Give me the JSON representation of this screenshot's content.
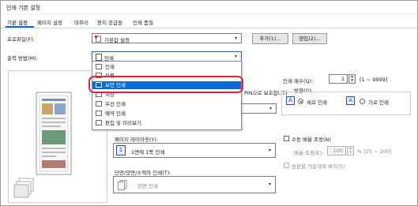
{
  "window": {
    "title": "인쇄 기본 설정"
  },
  "tabs": [
    {
      "label": "기본 설정"
    },
    {
      "label": "페이지 설정"
    },
    {
      "label": "마무리"
    },
    {
      "label": "용지 공급원"
    },
    {
      "label": "인쇄 품질"
    }
  ],
  "profile": {
    "label": "프로파일(F):",
    "value": "기본값 설정",
    "add_button": "추가(1)...",
    "edit_button": "편집(2)..."
  },
  "output_method": {
    "label": "출력 방법(M):",
    "value": "인쇄"
  },
  "dropdown": {
    "items": [
      {
        "label": "인쇄"
      },
      {
        "label": "보류"
      },
      {
        "label": "보안 인쇄"
      },
      {
        "label": "저장"
      },
      {
        "label": "우선 인쇄"
      },
      {
        "label": "예약 인쇄"
      },
      {
        "label": "편집 및 미리보기"
      }
    ],
    "selected_index": 2
  },
  "pin_text": "PIN으로 보호합니다",
  "copies": {
    "label": "인쇄 매수(Q):",
    "value": "1",
    "range": "[1 ~ 9999]"
  },
  "orientation": {
    "label": "방향(O)",
    "portrait": "세로 인쇄",
    "landscape": "가로 인쇄",
    "selected": "portrait"
  },
  "page_layout": {
    "label": "페이지 레이아웃(Y):",
    "value": "1면에 1쪽 인쇄",
    "number": "1"
  },
  "manual_scaling": {
    "label": "수동 배율 조정(N)",
    "scale_label": "배율 조정(E):",
    "scale_value": "100",
    "scale_range": "% [25 ~ 200]",
    "sub_checkbox": "원본을 가운데에 배치(5)"
  },
  "duplex": {
    "label": "단면/양면/소책자 인쇄(T):",
    "value": "양면 인쇄"
  },
  "colors": {
    "accent": "#0a6ad8",
    "highlight": "#d2293b"
  }
}
